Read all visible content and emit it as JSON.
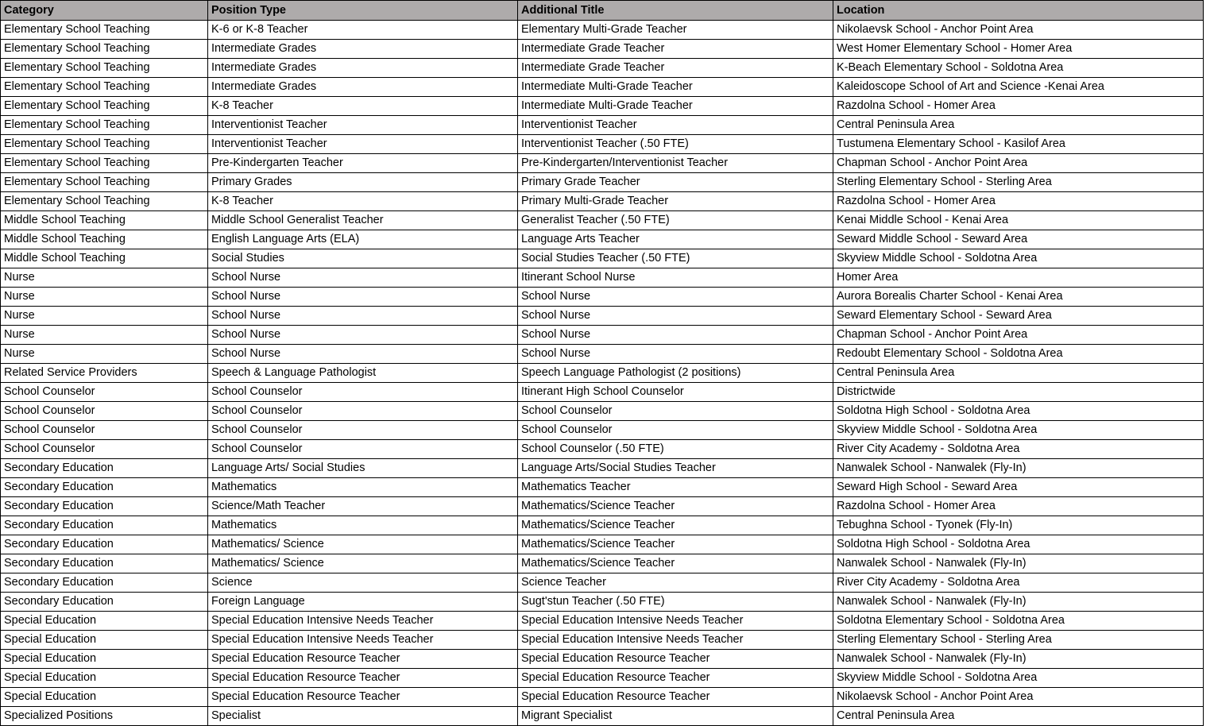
{
  "table": {
    "columns": [
      {
        "key": "category",
        "label": "Category"
      },
      {
        "key": "position_type",
        "label": "Position Type"
      },
      {
        "key": "additional_title",
        "label": "Additional Title"
      },
      {
        "key": "location",
        "label": "Location"
      }
    ],
    "header_background": "#AEABAB",
    "border_color": "#000000",
    "rows": [
      [
        "Elementary School Teaching",
        "K-6 or K-8 Teacher",
        "Elementary Multi-Grade Teacher",
        "Nikolaevsk School - Anchor Point Area"
      ],
      [
        "Elementary School Teaching",
        "Intermediate Grades",
        "Intermediate Grade Teacher",
        "West Homer Elementary School - Homer Area"
      ],
      [
        "Elementary School Teaching",
        "Intermediate Grades",
        "Intermediate Grade Teacher",
        "K-Beach Elementary School - Soldotna Area"
      ],
      [
        "Elementary School Teaching",
        "Intermediate Grades",
        "Intermediate Multi-Grade Teacher",
        "Kaleidoscope School of Art and Science -Kenai Area"
      ],
      [
        "Elementary School Teaching",
        "K-8 Teacher",
        "Intermediate Multi-Grade Teacher",
        "Razdolna School - Homer Area"
      ],
      [
        "Elementary School Teaching",
        "Interventionist Teacher",
        "Interventionist Teacher",
        "Central Peninsula Area"
      ],
      [
        "Elementary School Teaching",
        "Interventionist Teacher",
        "Interventionist Teacher (.50 FTE)",
        "Tustumena Elementary School - Kasilof Area"
      ],
      [
        "Elementary School Teaching",
        "Pre-Kindergarten Teacher",
        "Pre-Kindergarten/Interventionist Teacher",
        "Chapman School - Anchor Point Area"
      ],
      [
        "Elementary School Teaching",
        "Primary Grades",
        "Primary Grade Teacher",
        "Sterling Elementary School - Sterling Area"
      ],
      [
        "Elementary School Teaching",
        "K-8 Teacher",
        "Primary Multi-Grade Teacher",
        "Razdolna School - Homer Area"
      ],
      [
        "Middle School Teaching",
        "Middle School Generalist Teacher",
        "Generalist Teacher (.50 FTE)",
        "Kenai Middle School - Kenai Area"
      ],
      [
        "Middle School Teaching",
        "English Language Arts (ELA)",
        "Language Arts Teacher",
        "Seward Middle School - Seward Area"
      ],
      [
        "Middle School Teaching",
        "Social Studies",
        "Social Studies Teacher (.50 FTE)",
        "Skyview Middle School - Soldotna Area"
      ],
      [
        "Nurse",
        "School Nurse",
        "Itinerant School Nurse",
        "Homer Area"
      ],
      [
        "Nurse",
        "School Nurse",
        "School Nurse",
        "Aurora Borealis Charter School - Kenai Area"
      ],
      [
        "Nurse",
        "School Nurse",
        "School Nurse",
        "Seward Elementary School - Seward Area"
      ],
      [
        "Nurse",
        "School Nurse",
        "School Nurse",
        "Chapman School - Anchor Point Area"
      ],
      [
        "Nurse",
        "School Nurse",
        "School Nurse",
        "Redoubt Elementary School - Soldotna Area"
      ],
      [
        "Related Service Providers",
        "Speech & Language Pathologist",
        "Speech Language Pathologist (2 positions)",
        "Central Peninsula Area"
      ],
      [
        "School Counselor",
        "School Counselor",
        "Itinerant High School Counselor",
        "Districtwide"
      ],
      [
        "School Counselor",
        "School Counselor",
        "School Counselor",
        "Soldotna High School - Soldotna Area"
      ],
      [
        "School Counselor",
        "School Counselor",
        "School Counselor",
        "Skyview Middle School - Soldotna Area"
      ],
      [
        "School Counselor",
        "School Counselor",
        "School Counselor (.50 FTE)",
        "River City Academy - Soldotna Area"
      ],
      [
        "Secondary Education",
        "Language Arts/ Social Studies",
        "Language Arts/Social Studies Teacher",
        "Nanwalek School - Nanwalek (Fly-In)"
      ],
      [
        "Secondary Education",
        "Mathematics",
        "Mathematics Teacher",
        "Seward High School - Seward Area"
      ],
      [
        "Secondary Education",
        "Science/Math Teacher",
        "Mathematics/Science Teacher",
        "Razdolna School - Homer Area"
      ],
      [
        "Secondary Education",
        "Mathematics",
        "Mathematics/Science Teacher",
        "Tebughna School - Tyonek (Fly-In)"
      ],
      [
        "Secondary Education",
        "Mathematics/ Science",
        "Mathematics/Science Teacher",
        "Soldotna High School - Soldotna Area"
      ],
      [
        "Secondary Education",
        "Mathematics/ Science",
        "Mathematics/Science Teacher",
        "Nanwalek School - Nanwalek (Fly-In)"
      ],
      [
        "Secondary Education",
        "Science",
        "Science Teacher",
        "River City Academy - Soldotna Area"
      ],
      [
        "Secondary Education",
        "Foreign Language",
        "Sugt'stun Teacher (.50 FTE)",
        "Nanwalek School - Nanwalek (Fly-In)"
      ],
      [
        "Special Education",
        "Special Education Intensive Needs Teacher",
        "Special Education Intensive Needs Teacher",
        "Soldotna Elementary School - Soldotna Area"
      ],
      [
        "Special Education",
        "Special Education Intensive Needs Teacher",
        "Special Education Intensive Needs Teacher",
        "Sterling Elementary School - Sterling Area"
      ],
      [
        "Special Education",
        "Special Education Resource Teacher",
        "Special Education Resource Teacher",
        "Nanwalek School - Nanwalek (Fly-In)"
      ],
      [
        "Special Education",
        "Special Education Resource Teacher",
        "Special Education Resource Teacher",
        "Skyview Middle School - Soldotna Area"
      ],
      [
        "Special Education",
        "Special Education Resource Teacher",
        "Special Education Resource Teacher",
        "Nikolaevsk School - Anchor Point Area"
      ],
      [
        "Specialized Positions",
        "Specialist",
        "Migrant Specialist",
        "Central Peninsula Area"
      ]
    ]
  }
}
